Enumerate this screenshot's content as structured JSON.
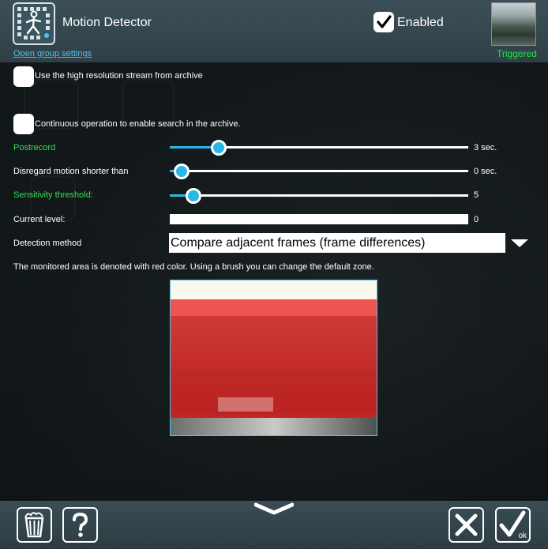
{
  "header": {
    "title": "Motion Detector",
    "group_link": "Open group settings",
    "enabled_label": "Enabled",
    "enabled_checked": true,
    "status": "Triggered",
    "app_icon": "walking-person-grid-icon"
  },
  "options": {
    "high_res_label": "Use the high resolution stream from archive",
    "high_res_checked": false,
    "continuous_label": "Continuous operation to enable search in the archive.",
    "continuous_checked": false
  },
  "sliders": {
    "postrecord": {
      "label": "Postrecord",
      "value": "3 sec.",
      "fraction": 0.16
    },
    "disregard": {
      "label": "Disregard motion shorter than",
      "value": "0 sec.",
      "fraction": 0.04
    },
    "sensitivity": {
      "label": "Sensitivity threshold:",
      "value": "5",
      "fraction": 0.08
    }
  },
  "level": {
    "label": "Current level:",
    "value": "0"
  },
  "detection": {
    "label": "Detection method",
    "selected": "Compare adjacent frames (frame differences)"
  },
  "zone_hint": "The monitored area is denoted with red color. Using a brush you can change the default zone.",
  "footer": {
    "delete_icon": "trash-icon",
    "help_icon": "question-icon",
    "cancel_icon": "close-icon",
    "ok_label": "ok"
  },
  "colors": {
    "accent": "#29b8e6",
    "link": "#4cc3ee",
    "green_text": "#2fe24f",
    "triggered": "#23e34b",
    "mask_red": "#eb1e1e"
  }
}
